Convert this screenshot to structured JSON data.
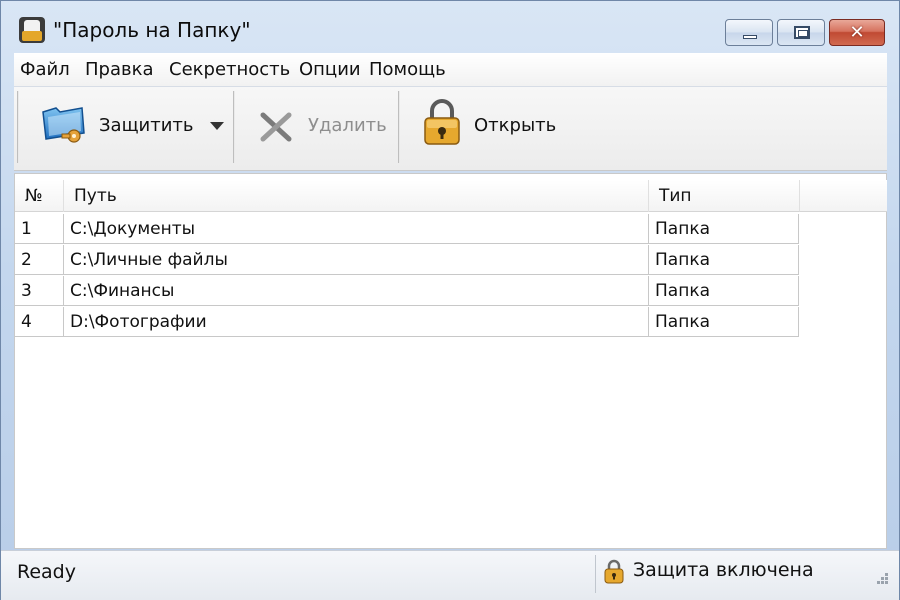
{
  "window": {
    "title": "\"Пароль на Папку\"",
    "close_glyph": "✕"
  },
  "menu": [
    "Файл",
    "Правка",
    "Секретность",
    "Опции",
    "Помощь"
  ],
  "toolbar": {
    "protect_label": "Защитить",
    "delete_label": "Удалить",
    "open_label": "Открыть",
    "icons": [
      "folder-key-icon",
      "delete-x-icon",
      "lock-icon",
      "chevron-down-icon"
    ]
  },
  "list": {
    "columns": [
      "№",
      "Путь",
      "Тип"
    ],
    "rows": [
      {
        "num": "1",
        "path": "C:\\Документы",
        "type": "Папка"
      },
      {
        "num": "2",
        "path": "C:\\Личные файлы",
        "type": "Папка"
      },
      {
        "num": "3",
        "path": "C:\\Финансы",
        "type": "Папка"
      },
      {
        "num": "4",
        "path": "D:\\Фотографии",
        "type": "Папка"
      }
    ]
  },
  "status": {
    "left": "Ready",
    "right": "Защита включена"
  },
  "colors": {
    "title_bar": "#c4d7ee",
    "close_button": "#c04a33",
    "lock_gold": "#e4a72a"
  }
}
